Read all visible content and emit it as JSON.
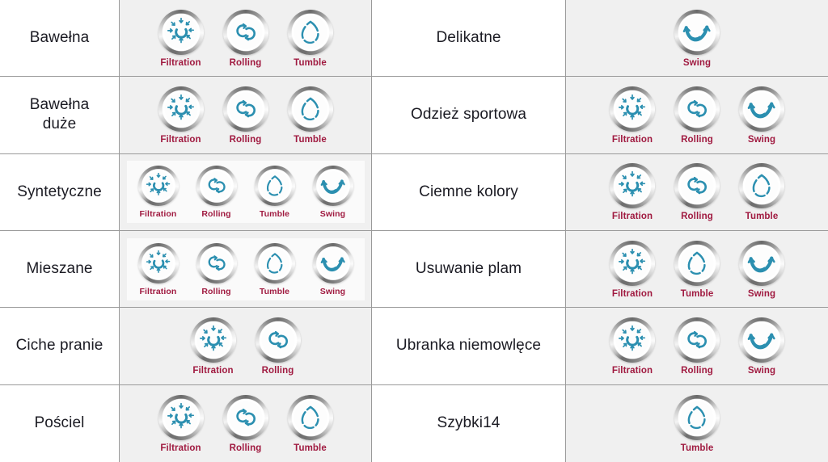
{
  "colors": {
    "icon_teal": "#2b8fb0",
    "label_crimson": "#a01a40",
    "name_text": "#1b1b23",
    "cell_background": "#f0f0f0",
    "name_background": "#ffffff",
    "grid_line": "#9a9a9a",
    "panel_light": "#fafafa"
  },
  "icon_labels": {
    "filtration": "Filtration",
    "rolling": "Rolling",
    "tumble": "Tumble",
    "swing": "Swing"
  },
  "table": {
    "columns": 2,
    "rows": [
      {
        "left": {
          "name": "Bawełna",
          "icons": [
            {
              "label": "Filtration",
              "icon": "filtration-icon"
            },
            {
              "label": "Rolling",
              "icon": "rolling-icon"
            },
            {
              "label": "Tumble",
              "icon": "tumble-icon"
            }
          ]
        },
        "right": {
          "name": "Delikatne",
          "icons": [
            {
              "label": "Swing",
              "icon": "swing-icon"
            }
          ]
        }
      },
      {
        "left": {
          "name": "Bawełna\nduże",
          "icons": [
            {
              "label": "Filtration",
              "icon": "filtration-icon"
            },
            {
              "label": "Rolling",
              "icon": "rolling-icon"
            },
            {
              "label": "Tumble",
              "icon": "tumble-icon"
            }
          ]
        },
        "right": {
          "name": "Odzież sportowa",
          "icons": [
            {
              "label": "Filtration",
              "icon": "filtration-icon"
            },
            {
              "label": "Rolling",
              "icon": "rolling-icon"
            },
            {
              "label": "Swing",
              "icon": "swing-icon"
            }
          ]
        }
      },
      {
        "left": {
          "name": "Syntetyczne",
          "icons": [
            {
              "label": "Filtration",
              "icon": "filtration-icon"
            },
            {
              "label": "Rolling",
              "icon": "rolling-icon"
            },
            {
              "label": "Tumble",
              "icon": "tumble-icon"
            },
            {
              "label": "Swing",
              "icon": "swing-icon"
            }
          ]
        },
        "right": {
          "name": "Ciemne kolory",
          "icons": [
            {
              "label": "Filtration",
              "icon": "filtration-icon"
            },
            {
              "label": "Rolling",
              "icon": "rolling-icon"
            },
            {
              "label": "Tumble",
              "icon": "tumble-icon"
            }
          ]
        }
      },
      {
        "left": {
          "name": "Mieszane",
          "icons": [
            {
              "label": "Filtration",
              "icon": "filtration-icon"
            },
            {
              "label": "Rolling",
              "icon": "rolling-icon"
            },
            {
              "label": "Tumble",
              "icon": "tumble-icon"
            },
            {
              "label": "Swing",
              "icon": "swing-icon"
            }
          ]
        },
        "right": {
          "name": "Usuwanie plam",
          "icons": [
            {
              "label": "Filtration",
              "icon": "filtration-icon"
            },
            {
              "label": "Tumble",
              "icon": "tumble-icon"
            },
            {
              "label": "Swing",
              "icon": "swing-icon"
            }
          ]
        }
      },
      {
        "left": {
          "name": "Ciche pranie",
          "icons": [
            {
              "label": "Filtration",
              "icon": "filtration-icon"
            },
            {
              "label": "Rolling",
              "icon": "rolling-icon"
            }
          ]
        },
        "right": {
          "name": "Ubranka niemowlęce",
          "icons": [
            {
              "label": "Filtration",
              "icon": "filtration-icon"
            },
            {
              "label": "Rolling",
              "icon": "rolling-icon"
            },
            {
              "label": "Swing",
              "icon": "swing-icon"
            }
          ]
        }
      },
      {
        "left": {
          "name": "Pościel",
          "icons": [
            {
              "label": "Filtration",
              "icon": "filtration-icon"
            },
            {
              "label": "Rolling",
              "icon": "rolling-icon"
            },
            {
              "label": "Tumble",
              "icon": "tumble-icon"
            }
          ]
        },
        "right": {
          "name": "Szybki14",
          "icons": [
            {
              "label": "Tumble",
              "icon": "tumble-icon"
            }
          ]
        }
      }
    ]
  }
}
